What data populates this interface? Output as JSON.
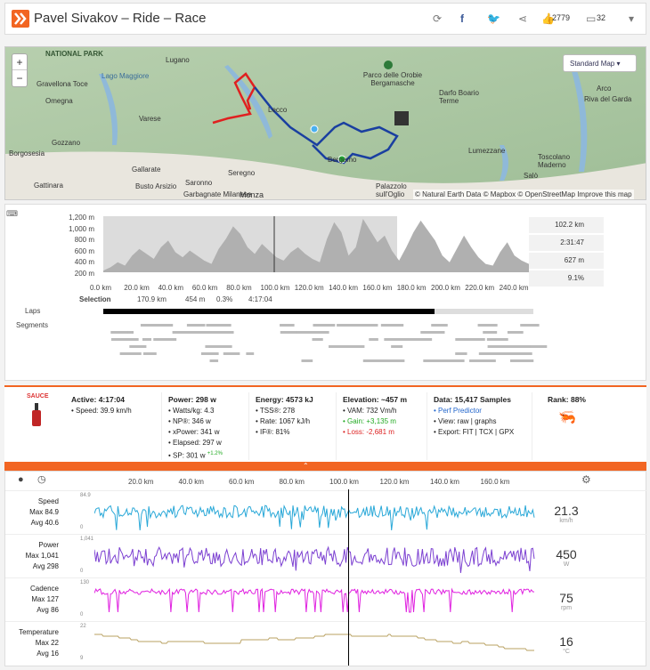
{
  "header": {
    "title": "Pavel Sivakov – Ride – Race",
    "kudos": "2779",
    "comments": "32"
  },
  "map": {
    "type_label": "Standard Map",
    "attribution": "© Natural Earth Data © Mapbox © OpenStreetMap Improve this map",
    "labels": [
      "NATIONAL PARK",
      "Lugano",
      "Lago Maggiore",
      "Gravellona Toce",
      "Omegna",
      "Varese",
      "Lecco",
      "Parco delle Orobie Bergamasche",
      "Gozzano",
      "Borgosesia",
      "Gallarate",
      "Busto Arsizio",
      "Gattinara",
      "Saronno",
      "Garbagnate Milanese",
      "Seregno",
      "Monza",
      "Bergamo",
      "Palazzolo sull'Oglio",
      "Lumezzane",
      "Darfo Boario Terme",
      "Arco",
      "Riva del Garda",
      "Toscolano Maderno",
      "Salò"
    ]
  },
  "elevation": {
    "yticks": [
      "1,200 m",
      "1,000 m",
      "800 m",
      "600 m",
      "400 m",
      "200 m"
    ],
    "xticks": [
      "0.0 km",
      "20.0 km",
      "40.0 km",
      "60.0 km",
      "80.0 km",
      "100.0 km",
      "120.0 km",
      "140.0 km",
      "160.0 km",
      "180.0 km",
      "200.0 km",
      "220.0 km",
      "240.0 km"
    ],
    "stats": [
      "102.2 km",
      "2:31:47",
      "627 m",
      "9.1%"
    ],
    "selection_label": "Selection",
    "selection": [
      "170.9 km",
      "454 m",
      "0.3%",
      "4:17:04"
    ],
    "laps_label": "Laps",
    "segments_label": "Segments"
  },
  "summary": {
    "sauce": "SAUCE",
    "active": {
      "title": "Active: 4:17:04",
      "speed": "• Speed: 39.9 km/h"
    },
    "power": {
      "title": "Power: 298 w",
      "items": [
        "• Watts/kg: 4.3",
        "• NP®: 346 w",
        "• xPower: 341 w",
        "• Elapsed: 297 w",
        "• SP: 301 w"
      ],
      "sp_delta": "+1.2%"
    },
    "energy": {
      "title": "Energy: 4573 kJ",
      "items": [
        "• TSS®: 278",
        "• Rate: 1067 kJ/h",
        "• IF®: 81%"
      ]
    },
    "elevation": {
      "title": "Elevation: ~457 m",
      "items": [
        "• VAM: 732 Vm/h",
        "• Gain: +3,135 m",
        "• Loss: -2,681 m"
      ]
    },
    "data": {
      "title": "Data: 15,417 Samples",
      "perf": "• Perf Predictor",
      "view": "• View: raw | graphs",
      "export": "• Export: FIT | TCX | GPX"
    },
    "rank": {
      "title": "Rank: 88%"
    }
  },
  "streams": {
    "xticks": [
      "20.0 km",
      "40.0 km",
      "60.0 km",
      "80.0 km",
      "100.0 km",
      "120.0 km",
      "140.0 km",
      "160.0 km"
    ],
    "rows": [
      {
        "name": "Speed",
        "max": "Max 84.9",
        "avg": "Avg 40.6",
        "ytop": "84.9",
        "ybot": "0",
        "value": "21.3",
        "unit": "km/h",
        "color": "#29a8d8"
      },
      {
        "name": "Power",
        "max": "Max 1,041",
        "avg": "Avg 298",
        "ytop": "1,041",
        "ybot": "0",
        "value": "450",
        "unit": "W",
        "color": "#7b3fd1"
      },
      {
        "name": "Cadence",
        "max": "Max 127",
        "avg": "Avg 86",
        "ytop": "130",
        "ybot": "0",
        "value": "75",
        "unit": "rpm",
        "color": "#e020e0"
      },
      {
        "name": "Temperature",
        "max": "Max 22",
        "avg": "Avg 16",
        "ytop": "22",
        "ybot": "9",
        "value": "16",
        "unit": "°C",
        "color": "#b8a060"
      }
    ]
  }
}
